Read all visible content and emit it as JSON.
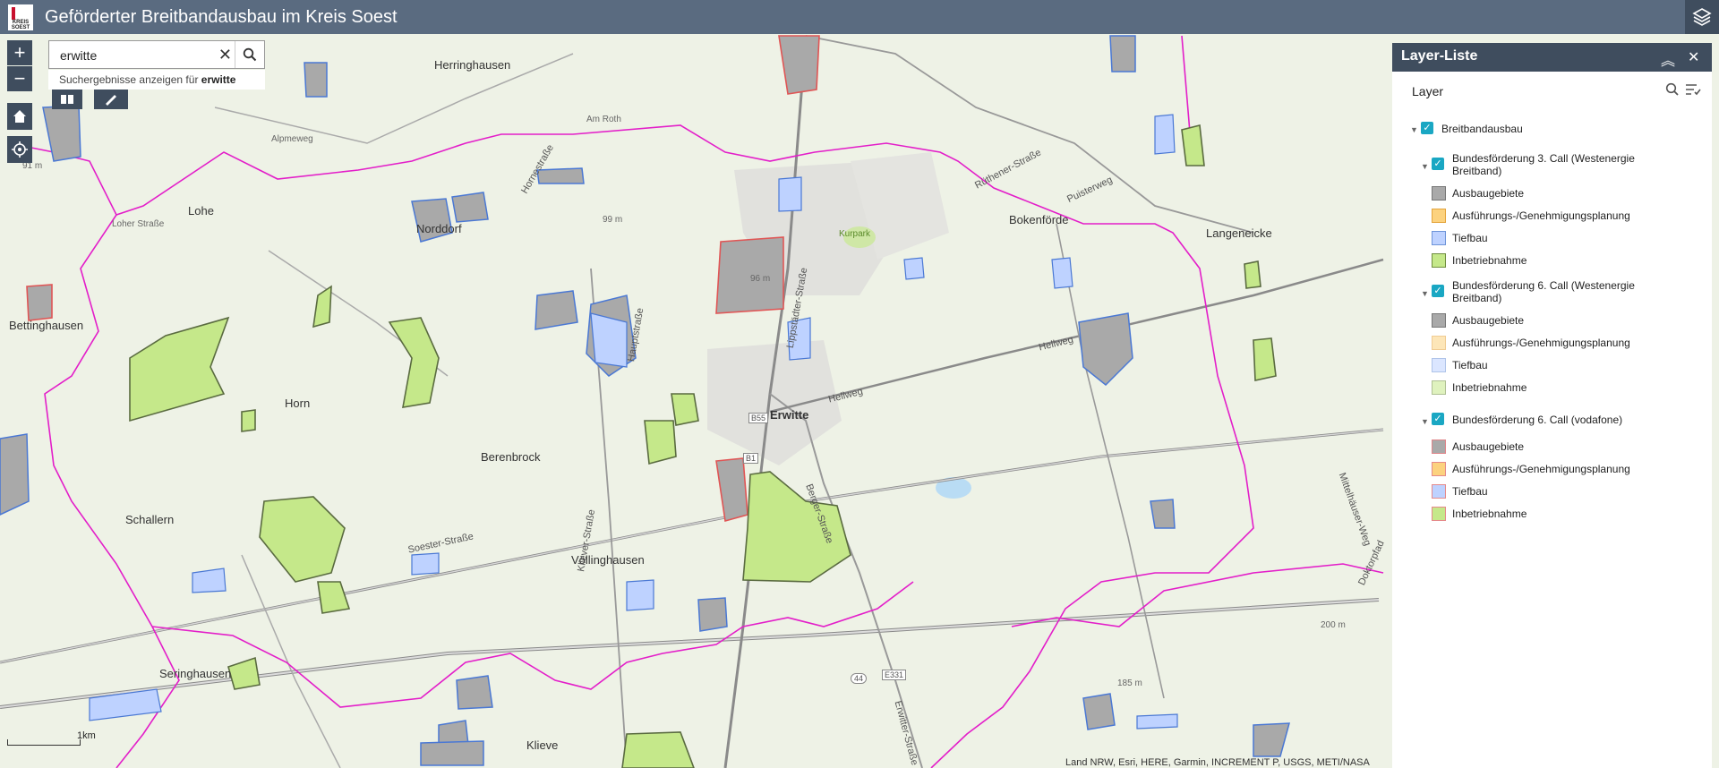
{
  "app": {
    "title": "Geförderter Breitbandausbau im Kreis Soest",
    "logo_line1": "KREIS",
    "logo_line2": "SOEST"
  },
  "search": {
    "value": "erwitte",
    "suggest_prefix": "Suchergebnisse anzeigen für",
    "suggest_term": "erwitte"
  },
  "map_labels": {
    "herringhausen": "Herringhausen",
    "lohe": "Lohe",
    "norddorf": "Norddorf",
    "bettinghausen": "Bettinghausen",
    "horn": "Horn",
    "berenbrock": "Berenbrock",
    "schallern": "Schallern",
    "voellinghausen": "Völlinghausen",
    "seringhausen": "Seringhausen",
    "erwitte": "Erwitte",
    "bokenfoerde": "Bokenförde",
    "langeneicke": "Langeneicke",
    "klieve": "Klieve",
    "kurpark": "Kurpark",
    "elev_99": "99 m",
    "elev_96": "96 m",
    "elev_91": "91 m",
    "elev_185": "185 m",
    "elev_200": "200 m",
    "am_roth": "Am Roth",
    "alpmeweg": "Alpmeweg",
    "loher_strasse": "Loher Straße",
    "soester_strasse": "Soester-Straße",
    "hellweg": "Hellweg",
    "puisterweg": "Puisterweg",
    "ruethener_strasse": "Rüthener-Straße",
    "lippstaedter_strasse": "Lippstädter-Straße",
    "berger_strasse": "Berger-Straße",
    "kliever_strasse": "Kliever-Straße",
    "erwitter_strasse": "Erwitter-Straße",
    "hauptstrasse": "Hauptstraße",
    "hornestrasse": "Hornestraße",
    "doktorpfad": "Doktorpfad",
    "mittelhaeuser_weg": "Mittelhäuser-Weg",
    "b55": "B55",
    "b1": "B1",
    "a44": "44",
    "e331": "E331",
    "scale": "1km",
    "attribution": "Land NRW, Esri, HERE, Garmin, INCREMENT P, USGS, METI/NASA"
  },
  "layer_panel": {
    "title": "Layer-Liste",
    "subtitle": "Layer",
    "root": "Breitbandausbau",
    "groups": [
      {
        "name": "Bundesförderung 3. Call (Westenergie Breitband)",
        "name_line1": "Bundesförderung 3. Call (Westenergie",
        "name_line2": "Breitband)",
        "items": [
          "Ausbaugebiete",
          "Ausführungs-/Genehmigungsplanung",
          "Tiefbau",
          "Inbetriebnahme"
        ]
      },
      {
        "name": "Bundesförderung 6. Call (Westenergie Breitband)",
        "name_line1": "Bundesförderung 6. Call (Westenergie",
        "name_line2": "Breitband)",
        "items": [
          "Ausbaugebiete",
          "Ausführungs-/Genehmigungsplanung",
          "Tiefbau",
          "Inbetriebnahme"
        ]
      },
      {
        "name": "Bundesförderung 6. Call (vodafone)",
        "items": [
          "Ausbaugebiete",
          "Ausführungs-/Genehmigungsplanung",
          "Tiefbau",
          "Inbetriebnahme"
        ]
      }
    ]
  },
  "colors": {
    "boundary": "#e31ec9",
    "ausbaugebiete": "#a9a9a9",
    "planung": "#fcd27f",
    "tiefbau": "#bed2ff",
    "inbetriebnahme": "#c5e88a"
  }
}
